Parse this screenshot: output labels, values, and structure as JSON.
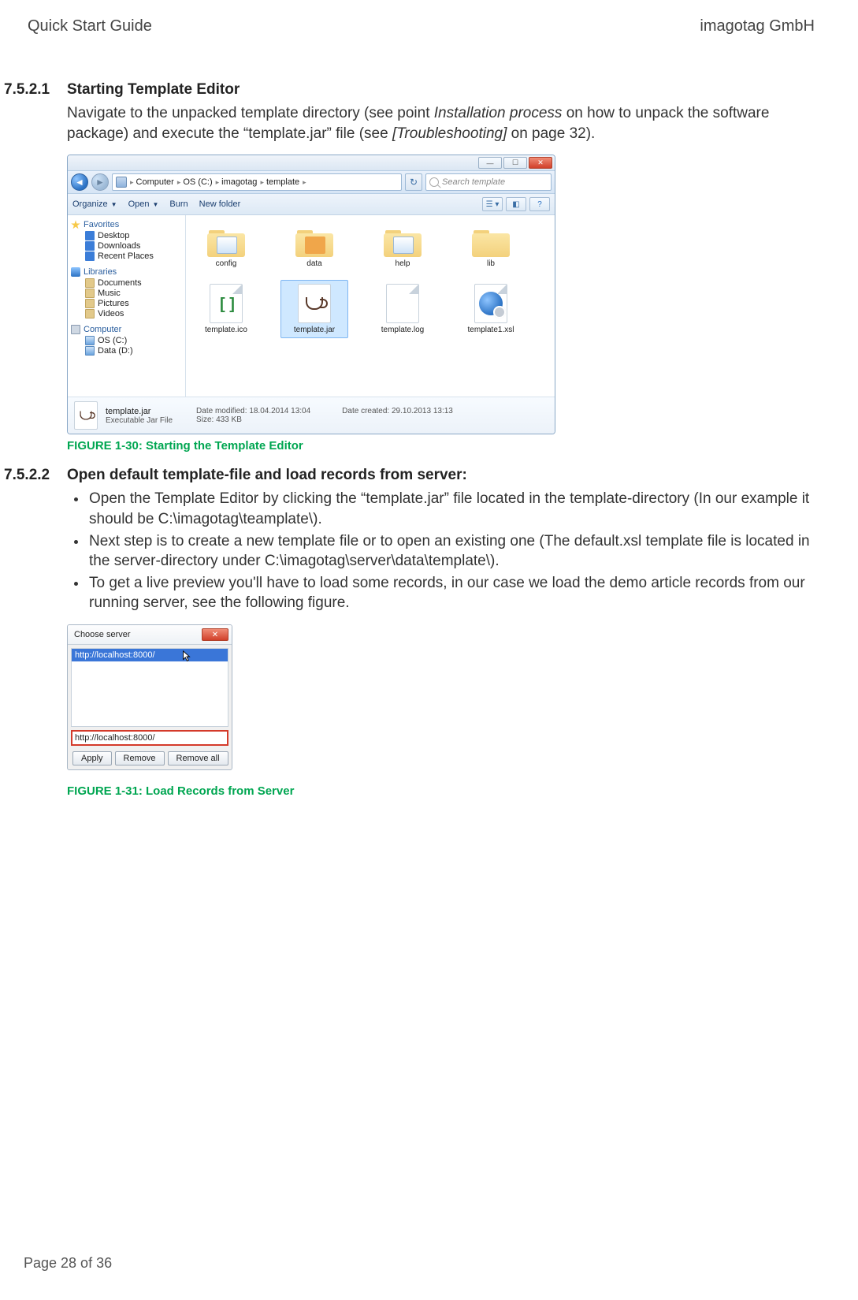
{
  "header": {
    "left": "Quick Start Guide",
    "right": "imagotag GmbH"
  },
  "footer": "Page 28 of 36",
  "s7521": {
    "num": "7.5.2.1",
    "title": "Starting Template Editor",
    "para_a": "Navigate to the unpacked template directory (see point ",
    "para_i1": "Installation process",
    "para_b": " on how to unpack the software package) and execute the “template.jar” file (see ",
    "para_i2": "[Troubleshooting]",
    "para_c": " on page 32)."
  },
  "fig30": "FIGURE 1-30: Starting the Template Editor",
  "s7522": {
    "num": "7.5.2.2",
    "title": "Open default template-file and load records from server:",
    "b1": "Open the Template Editor by clicking the “template.jar” file located in the template-directory (In our example it should be C:\\imagotag\\teamplate\\).",
    "b2": "Next step is to create a new template file or to open an existing one (The default.xsl template file is located in the server-directory under C:\\imagotag\\server\\data\\template\\).",
    "b3": "To get a live preview you'll have to load some records, in our case we load the demo article records from our running server, see the following figure."
  },
  "fig31": "FIGURE 1-31: Load Records from Server",
  "explorer": {
    "crumbs": [
      "Computer",
      "OS (C:)",
      "imagotag",
      "template"
    ],
    "search_placeholder": "Search template",
    "toolbar": {
      "organize": "Organize",
      "open": "Open",
      "burn": "Burn",
      "newfolder": "New folder"
    },
    "tree": {
      "favorites": "Favorites",
      "fav_items": [
        "Desktop",
        "Downloads",
        "Recent Places"
      ],
      "libraries": "Libraries",
      "lib_items": [
        "Documents",
        "Music",
        "Pictures",
        "Videos"
      ],
      "computer": "Computer",
      "comp_items": [
        "OS (C:)",
        "Data (D:)"
      ]
    },
    "files": [
      "config",
      "data",
      "help",
      "lib",
      "template.ico",
      "template.jar",
      "template.log",
      "template1.xsl"
    ],
    "details": {
      "name": "template.jar",
      "type": "Executable Jar File",
      "mod_label": "Date modified:",
      "mod": "18.04.2014 13:04",
      "size_label": "Size:",
      "size": "433 KB",
      "created_label": "Date created:",
      "created": "29.10.2013 13:13"
    }
  },
  "chooser": {
    "title": "Choose server",
    "list_item": "http://localhost:8000/",
    "input_value": "http://localhost:8000/",
    "apply": "Apply",
    "remove": "Remove",
    "remove_all": "Remove all"
  }
}
